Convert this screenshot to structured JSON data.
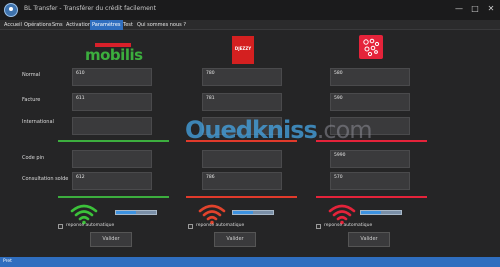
{
  "window": {
    "title": "BL Transfer - Transférer du crédit facilement",
    "minimize_icon": "minimize-icon",
    "maximize_icon": "maximize-icon",
    "close_icon": "close-icon"
  },
  "menu": [
    {
      "label": "Accueil"
    },
    {
      "label": "Opérations"
    },
    {
      "label": "Sms"
    },
    {
      "label": "Activation"
    },
    {
      "label": "Paramètres",
      "active": true
    },
    {
      "label": "Test"
    },
    {
      "label": "Qui sommes nous ?"
    }
  ],
  "rows": {
    "normal": "Normal",
    "facture": "Facture",
    "international": "International",
    "code_pin": "Code pin",
    "consultation_solde": "Consultation solde"
  },
  "operators": [
    {
      "name": "mobilis",
      "logo_text": "mobilis",
      "color": "#3cae3e",
      "normal": "610",
      "facture": "611",
      "international": "",
      "code_pin": "",
      "consultation": "612",
      "signal_fraction": 0.5,
      "auto_reply_label": "reponse automatique",
      "valider_label": "Valider"
    },
    {
      "name": "djezzy",
      "logo_text": "DJEZZY",
      "color": "#e13a2b",
      "normal": "780",
      "facture": "781",
      "international": "",
      "code_pin": "",
      "consultation": "786",
      "signal_fraction": 0.5,
      "auto_reply_label": "reponse automatique",
      "valider_label": "Valider"
    },
    {
      "name": "ooredoo",
      "logo_text": "",
      "color": "#e5233a",
      "normal": "580",
      "facture": "590",
      "international": "",
      "code_pin": "5990",
      "consultation": "570",
      "signal_fraction": 0.5,
      "auto_reply_label": "reponse automatique",
      "valider_label": "Valider"
    }
  ],
  "watermark": {
    "main": "Ouedkniss",
    "suffix": ".com"
  },
  "status": {
    "text": "Pret"
  }
}
